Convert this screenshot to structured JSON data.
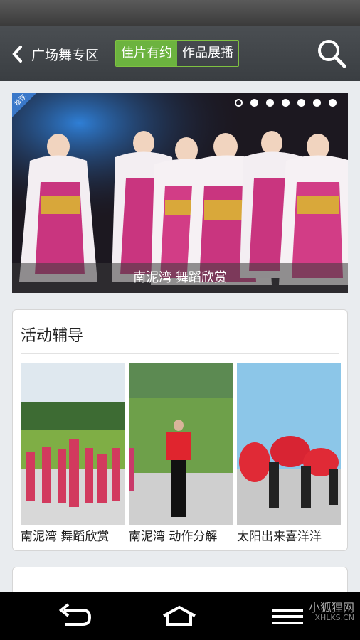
{
  "nav": {
    "title": "广场舞专区",
    "tabs": [
      {
        "label": "佳片有约",
        "active": true
      },
      {
        "label": "作品展播",
        "active": false
      }
    ],
    "accent": "#6cb33f"
  },
  "banner": {
    "badge": "推荐",
    "caption": "南泥湾 舞蹈欣赏",
    "dot_count": 7,
    "active_dot": 1
  },
  "activity": {
    "title": "活动辅导",
    "items": [
      {
        "label": "南泥湾 舞蹈欣赏"
      },
      {
        "label": "南泥湾 动作分解"
      },
      {
        "label": "太阳出来喜洋洋"
      }
    ]
  },
  "watermark": {
    "line1": "小狐狸网",
    "line2": "XHLKS.CN"
  }
}
